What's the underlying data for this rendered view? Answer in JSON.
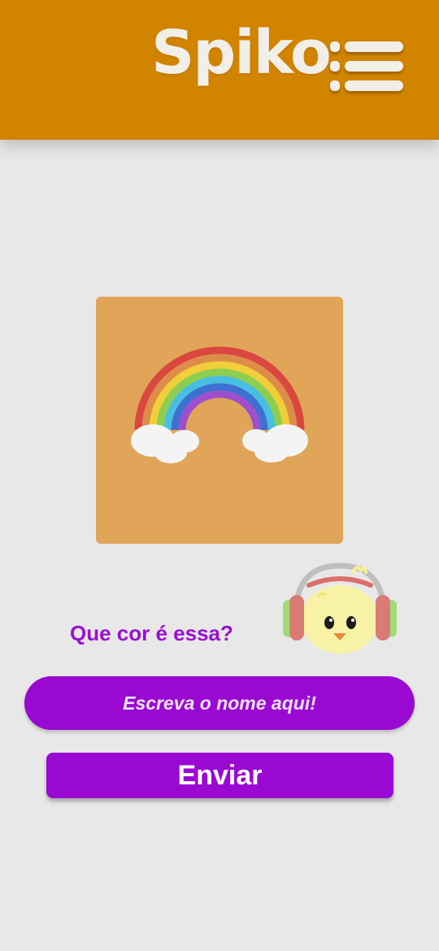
{
  "header": {
    "logo_text": "Spiko",
    "menu_icon": "hamburger-menu-icon",
    "background_color": "#d18400"
  },
  "quiz": {
    "image_icon": "rainbow-with-clouds-icon",
    "card_color": "#e0a559",
    "mascot_icon": "chick-with-headphones-icon",
    "question": "Que cor é essa?",
    "answer_placeholder": "Escreva o nome aqui!",
    "answer_value": "",
    "submit_label": "Enviar",
    "accent_color": "#9a09d2"
  }
}
